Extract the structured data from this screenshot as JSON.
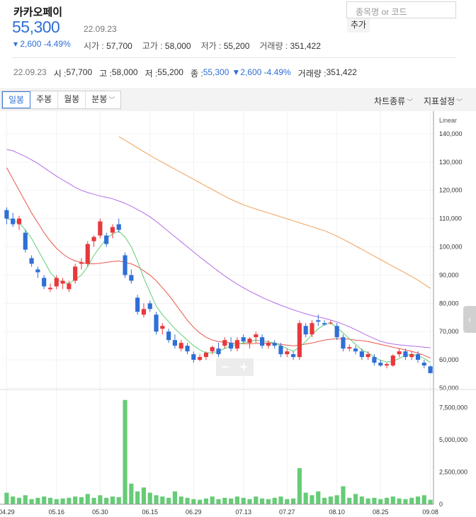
{
  "header": {
    "name": "카카오페이",
    "price": "55,300",
    "date": "22.09.23",
    "change": "▾ 2,600 -4.49%",
    "summary": [
      {
        "label": "시가 : ",
        "value": "57,700"
      },
      {
        "label": "고가 : ",
        "value": "58,000"
      },
      {
        "label": "저가 : ",
        "value": "55,200"
      },
      {
        "label": "거래량 : ",
        "value": "351,422"
      }
    ]
  },
  "search": {
    "placeholder": "종목명 or 코드",
    "add_label": "추가"
  },
  "detail": {
    "date": "22.09.23",
    "open_label": "시 : ",
    "open": "57,700",
    "high_label": "고 : ",
    "high": "58,000",
    "low_label": "저 : ",
    "low": "55,200",
    "close_label": "종 : ",
    "close": "55,300",
    "change": "▼2,600 -4.49%",
    "volume_label": "거래량 : ",
    "volume": "351,422"
  },
  "toolbar": {
    "tabs": [
      "일봉",
      "주봉",
      "월봉",
      "분봉"
    ],
    "active_tab": "일봉",
    "chart_type_label": "차트종류",
    "indicator_label": "지표설정"
  },
  "colors": {
    "up": "#e8383d",
    "down": "#2f6fd6",
    "ma5": "#5fcf72",
    "ma20": "#e8574b",
    "ma60": "#b36ce8",
    "ma120": "#f0a15a",
    "volume": "#66cc77"
  },
  "chart_data": {
    "type": "candlestick",
    "price_axis_label": "Linear",
    "price_ticks": [
      "140,000",
      "130,000",
      "120,000",
      "110,000",
      "100,000",
      "90,000",
      "80,000",
      "70,000",
      "60,000",
      "50,000"
    ],
    "price_range": [
      50000,
      145000
    ],
    "volume_ticks": [
      "7,500,000",
      "5,000,000",
      "2,500,000",
      "0"
    ],
    "volume_range": [
      0,
      8800000
    ],
    "x_ticks": [
      "04.29",
      "05.16",
      "05.30",
      "06.15",
      "06.29",
      "07.13",
      "07.27",
      "08.10",
      "08.25",
      "09.08"
    ],
    "candles": [
      {
        "o": 113000,
        "h": 114000,
        "l": 108000,
        "c": 110000
      },
      {
        "o": 110000,
        "h": 112000,
        "l": 107000,
        "c": 108000
      },
      {
        "o": 108000,
        "h": 111000,
        "l": 106000,
        "c": 110000
      },
      {
        "o": 105000,
        "h": 106000,
        "l": 98000,
        "c": 99000
      },
      {
        "o": 96000,
        "h": 97000,
        "l": 93000,
        "c": 94000
      },
      {
        "o": 92000,
        "h": 93000,
        "l": 89000,
        "c": 91000
      },
      {
        "o": 89000,
        "h": 90000,
        "l": 85000,
        "c": 86000
      },
      {
        "o": 85000,
        "h": 87000,
        "l": 84000,
        "c": 85500
      },
      {
        "o": 86000,
        "h": 90000,
        "l": 85000,
        "c": 89000
      },
      {
        "o": 87000,
        "h": 89000,
        "l": 85000,
        "c": 88000
      },
      {
        "o": 85000,
        "h": 88000,
        "l": 84000,
        "c": 87000
      },
      {
        "o": 88000,
        "h": 94000,
        "l": 87000,
        "c": 93000
      },
      {
        "o": 94000,
        "h": 96000,
        "l": 92000,
        "c": 94500
      },
      {
        "o": 94000,
        "h": 102000,
        "l": 93000,
        "c": 101000
      },
      {
        "o": 102000,
        "h": 104000,
        "l": 100000,
        "c": 103500
      },
      {
        "o": 104000,
        "h": 110000,
        "l": 103000,
        "c": 109000
      },
      {
        "o": 104000,
        "h": 105000,
        "l": 100000,
        "c": 101000
      },
      {
        "o": 105000,
        "h": 108000,
        "l": 103000,
        "c": 107000
      },
      {
        "o": 108000,
        "h": 110000,
        "l": 105000,
        "c": 106000
      },
      {
        "o": 97000,
        "h": 98000,
        "l": 89000,
        "c": 90000
      },
      {
        "o": 90000,
        "h": 92000,
        "l": 87000,
        "c": 88000
      },
      {
        "o": 82000,
        "h": 83000,
        "l": 76000,
        "c": 77000
      },
      {
        "o": 76000,
        "h": 80000,
        "l": 75000,
        "c": 78000
      },
      {
        "o": 80000,
        "h": 81000,
        "l": 77000,
        "c": 78000
      },
      {
        "o": 76000,
        "h": 77000,
        "l": 69000,
        "c": 70000
      },
      {
        "o": 71000,
        "h": 73000,
        "l": 69000,
        "c": 72000
      },
      {
        "o": 70000,
        "h": 71000,
        "l": 66000,
        "c": 67000
      },
      {
        "o": 67000,
        "h": 69000,
        "l": 64000,
        "c": 65000
      },
      {
        "o": 64000,
        "h": 67000,
        "l": 63000,
        "c": 66000
      },
      {
        "o": 65000,
        "h": 66000,
        "l": 62000,
        "c": 63000
      },
      {
        "o": 62000,
        "h": 63000,
        "l": 59000,
        "c": 60000
      },
      {
        "o": 60000,
        "h": 62000,
        "l": 59500,
        "c": 61000
      },
      {
        "o": 61000,
        "h": 63000,
        "l": 60000,
        "c": 62500
      },
      {
        "o": 63000,
        "h": 65000,
        "l": 62000,
        "c": 64500
      },
      {
        "o": 64000,
        "h": 66000,
        "l": 61000,
        "c": 62000
      },
      {
        "o": 65000,
        "h": 68000,
        "l": 64000,
        "c": 67000
      },
      {
        "o": 66000,
        "h": 68000,
        "l": 63000,
        "c": 64000
      },
      {
        "o": 64000,
        "h": 68000,
        "l": 63000,
        "c": 67000
      },
      {
        "o": 68000,
        "h": 69000,
        "l": 66000,
        "c": 66500
      },
      {
        "o": 66000,
        "h": 68000,
        "l": 64000,
        "c": 67500
      },
      {
        "o": 68000,
        "h": 70000,
        "l": 66000,
        "c": 69000
      },
      {
        "o": 68000,
        "h": 69000,
        "l": 64000,
        "c": 65000
      },
      {
        "o": 65000,
        "h": 67000,
        "l": 64000,
        "c": 66000
      },
      {
        "o": 66000,
        "h": 67000,
        "l": 64000,
        "c": 65000
      },
      {
        "o": 65000,
        "h": 66000,
        "l": 61000,
        "c": 62000
      },
      {
        "o": 62000,
        "h": 64000,
        "l": 61000,
        "c": 63000
      },
      {
        "o": 62000,
        "h": 63000,
        "l": 60000,
        "c": 61000
      },
      {
        "o": 61000,
        "h": 74000,
        "l": 60000,
        "c": 73000
      },
      {
        "o": 72000,
        "h": 73000,
        "l": 68000,
        "c": 69000
      },
      {
        "o": 69000,
        "h": 74000,
        "l": 68000,
        "c": 73000
      },
      {
        "o": 74000,
        "h": 76000,
        "l": 72000,
        "c": 73500
      },
      {
        "o": 73000,
        "h": 74000,
        "l": 72000,
        "c": 72500
      },
      {
        "o": 73000,
        "h": 74000,
        "l": 72500,
        "c": 73200
      },
      {
        "o": 72000,
        "h": 73000,
        "l": 67000,
        "c": 68000
      },
      {
        "o": 68000,
        "h": 69000,
        "l": 63000,
        "c": 64000
      },
      {
        "o": 64000,
        "h": 65500,
        "l": 63000,
        "c": 64500
      },
      {
        "o": 64000,
        "h": 65000,
        "l": 62000,
        "c": 63000
      },
      {
        "o": 63000,
        "h": 64000,
        "l": 60000,
        "c": 61000
      },
      {
        "o": 61000,
        "h": 63000,
        "l": 60000,
        "c": 62000
      },
      {
        "o": 61000,
        "h": 62000,
        "l": 58000,
        "c": 59000
      },
      {
        "o": 59000,
        "h": 60000,
        "l": 57500,
        "c": 58000
      },
      {
        "o": 58000,
        "h": 59000,
        "l": 57000,
        "c": 58500
      },
      {
        "o": 58000,
        "h": 62000,
        "l": 57500,
        "c": 61500
      },
      {
        "o": 62000,
        "h": 64000,
        "l": 61000,
        "c": 63000
      },
      {
        "o": 63000,
        "h": 64000,
        "l": 60000,
        "c": 61000
      },
      {
        "o": 61000,
        "h": 63000,
        "l": 60000,
        "c": 62000
      },
      {
        "o": 62000,
        "h": 63000,
        "l": 59000,
        "c": 60000
      },
      {
        "o": 59000,
        "h": 60000,
        "l": 57000,
        "c": 58000
      },
      {
        "o": 57700,
        "h": 58000,
        "l": 55200,
        "c": 55300
      }
    ],
    "volumes": [
      900000,
      600000,
      500000,
      700000,
      400000,
      500000,
      600000,
      500000,
      400000,
      450000,
      500000,
      600000,
      550000,
      800000,
      500000,
      700000,
      500000,
      600000,
      550000,
      8100000,
      1600000,
      1000000,
      1300000,
      900000,
      700000,
      600000,
      500000,
      1000000,
      600000,
      500000,
      400000,
      350000,
      450000,
      600000,
      400000,
      500000,
      450000,
      600000,
      500000,
      400000,
      600000,
      450000,
      400000,
      500000,
      600000,
      400000,
      450000,
      2800000,
      900000,
      700000,
      1000000,
      500000,
      600000,
      700000,
      1400000,
      500000,
      800000,
      600000,
      450000,
      500000,
      400000,
      500000,
      600000,
      450000,
      400000,
      500000,
      600000,
      700000,
      350000
    ],
    "ma5": [
      110000,
      109500,
      108500,
      106000,
      103000,
      99000,
      95000,
      91000,
      88500,
      87500,
      87000,
      88500,
      90000,
      93000,
      97000,
      100000,
      103000,
      104500,
      105500,
      103500,
      100000,
      95000,
      89000,
      84000,
      79000,
      76000,
      73500,
      71000,
      69000,
      67000,
      65000,
      63500,
      62500,
      62500,
      63000,
      64000,
      65000,
      65500,
      66000,
      66500,
      67000,
      66800,
      66400,
      66000,
      65000,
      64000,
      63000,
      64500,
      66500,
      69000,
      71000,
      72500,
      73000,
      71500,
      69500,
      67500,
      65500,
      63500,
      62500,
      61000,
      59800,
      59200,
      59500,
      60500,
      61500,
      62000,
      61500,
      60500,
      59000
    ],
    "ma20": [
      128000,
      124000,
      120000,
      116000,
      112000,
      108500,
      105000,
      102000,
      99500,
      97500,
      96000,
      95000,
      94500,
      94000,
      94000,
      94200,
      94500,
      94800,
      95000,
      94500,
      94000,
      93000,
      91500,
      90000,
      88000,
      85500,
      83000,
      80000,
      77000,
      74000,
      71500,
      69500,
      68000,
      67000,
      66500,
      66200,
      66000,
      65800,
      65700,
      65700,
      65800,
      65900,
      66000,
      65800,
      65500,
      65200,
      65000,
      65200,
      65600,
      66000,
      66500,
      67000,
      67300,
      67500,
      67500,
      67300,
      67000,
      66800,
      66500,
      66000,
      65500,
      65000,
      64500,
      64000,
      63500,
      63000,
      62400,
      61600,
      60600
    ],
    "ma60": [
      134500,
      134000,
      133000,
      132000,
      130800,
      129500,
      128000,
      126500,
      125000,
      123700,
      122400,
      121000,
      120000,
      119200,
      118600,
      118000,
      117500,
      117000,
      116200,
      115400,
      114400,
      113200,
      112000,
      110600,
      109000,
      107200,
      105400,
      103600,
      101800,
      100000,
      98200,
      96400,
      94700,
      93000,
      91300,
      89700,
      88200,
      86800,
      85500,
      84300,
      83200,
      82100,
      81100,
      80200,
      79300,
      78500,
      77700,
      77000,
      76300,
      75700,
      75200,
      74700,
      74100,
      73400,
      72600,
      71700,
      70700,
      69600,
      68500,
      67500,
      66600,
      66000,
      65600,
      65300,
      65100,
      64900,
      64700,
      64500,
      64300
    ],
    "ma120": [
      null,
      null,
      null,
      null,
      null,
      null,
      null,
      null,
      null,
      null,
      null,
      null,
      null,
      null,
      null,
      null,
      null,
      null,
      139000,
      137700,
      136400,
      135000,
      133700,
      132400,
      131100,
      129900,
      128700,
      127500,
      126300,
      125100,
      123900,
      122700,
      121500,
      120300,
      119100,
      117900,
      116800,
      115800,
      114900,
      114100,
      113400,
      112700,
      112000,
      111300,
      110600,
      109900,
      109200,
      108500,
      107800,
      107100,
      106400,
      105700,
      104800,
      103800,
      102700,
      101500,
      100300,
      99100,
      97900,
      96700,
      95500,
      94300,
      93100,
      91900,
      90700,
      89500,
      88200,
      86800,
      85300
    ]
  }
}
